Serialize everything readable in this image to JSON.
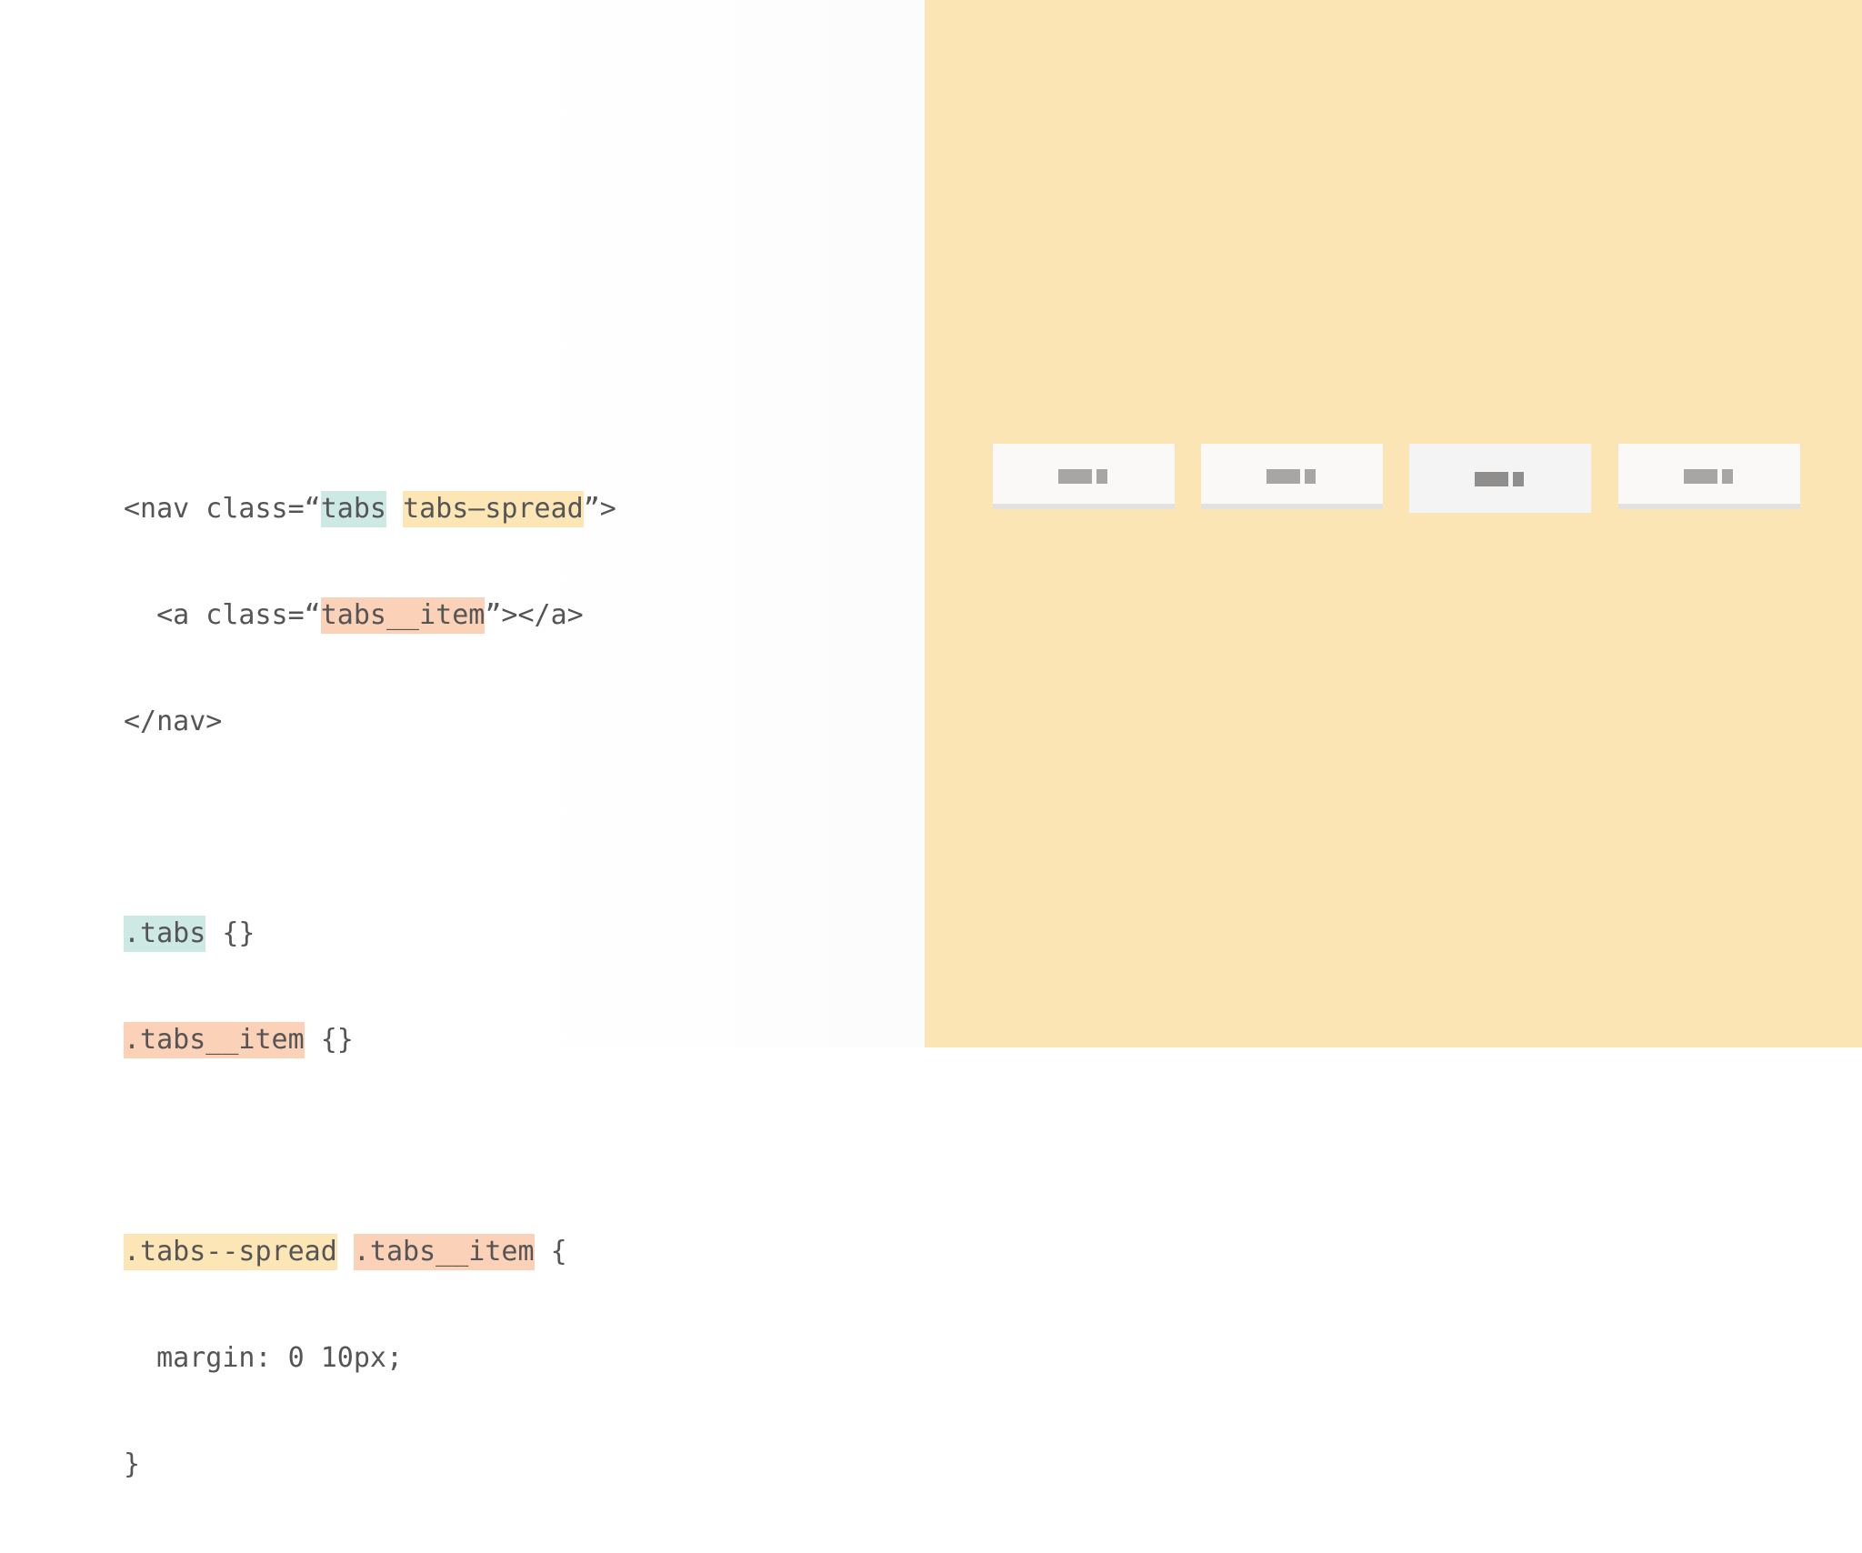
{
  "code": {
    "html": {
      "line1": {
        "prefix": "<nav class=“",
        "class_tabs": "tabs",
        "space": " ",
        "class_spread": "tabs–spread",
        "suffix": "”>"
      },
      "line2": {
        "prefix": "  <a class=“",
        "class_item": "tabs__item",
        "suffix": "”></a>"
      },
      "line3": "</nav>"
    },
    "css": {
      "rule1": {
        "selector": ".tabs",
        "body": " {}"
      },
      "rule2": {
        "selector": ".tabs__item",
        "body": " {}"
      },
      "rule3": {
        "selector_modifier": ".tabs--spread",
        "space": " ",
        "selector_item": ".tabs__item",
        "open": " {",
        "declaration": "  margin: 0 10px;",
        "close": "}"
      }
    }
  },
  "preview": {
    "tabs": [
      {
        "state": "inactive"
      },
      {
        "state": "inactive"
      },
      {
        "state": "active"
      },
      {
        "state": "inactive"
      }
    ]
  },
  "colors": {
    "highlight_tabs": "#cde9e3",
    "highlight_modifier": "#fce6b6",
    "highlight_item": "#fbd1b8",
    "preview_background": "#fce5b5",
    "code_text": "#555555"
  }
}
